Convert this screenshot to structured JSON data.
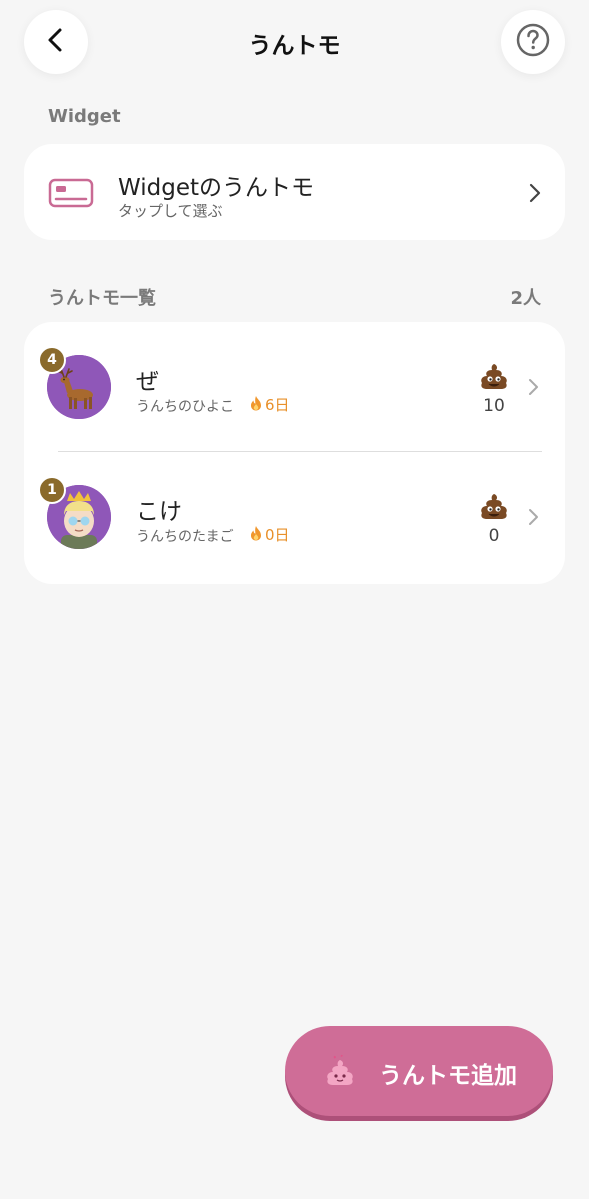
{
  "header": {
    "title": "うんトモ",
    "back_icon": "chevron-left-icon",
    "help_icon": "question-circle-icon"
  },
  "widget_section": {
    "label": "Widget",
    "card": {
      "icon": "card-icon",
      "title": "Widgetのうんトモ",
      "subtitle": "タップして選ぶ"
    }
  },
  "friends_section": {
    "label": "うんトモ一覧",
    "count": "2人",
    "friends": [
      {
        "rank": "4",
        "name": "ぜ",
        "status": "うんちのひよこ",
        "streak": "6日",
        "poop_count": "10",
        "avatar": "deer-avatar"
      },
      {
        "rank": "1",
        "name": "こけ",
        "status": "うんちのたまご",
        "streak": "0日",
        "poop_count": "0",
        "avatar": "character-avatar"
      }
    ]
  },
  "add_button": {
    "label": "うんトモ追加",
    "icon": "pink-poop-icon"
  },
  "colors": {
    "background": "#f6f6f6",
    "accent_pink": "#cf6d97",
    "avatar_purple": "#8f57b8",
    "badge_gold": "#8a6a2b",
    "streak_orange": "#e8902a"
  }
}
